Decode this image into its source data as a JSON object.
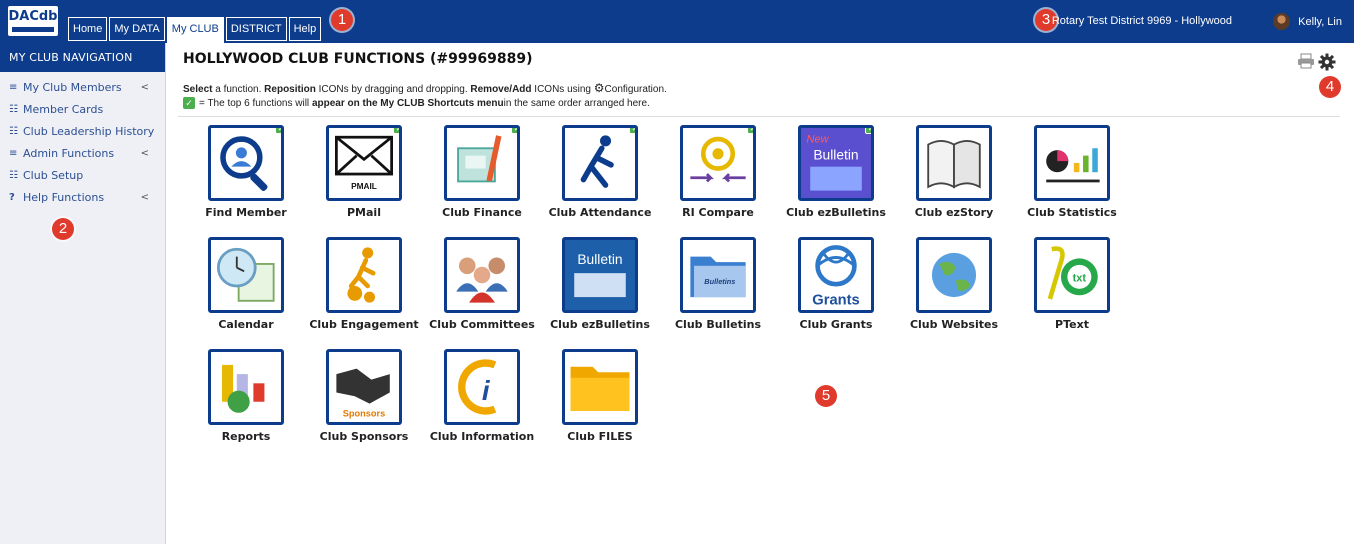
{
  "header": {
    "logo": "DACdb",
    "tabs": [
      {
        "label": "Home"
      },
      {
        "label": "My DATA"
      },
      {
        "label": "My CLUB"
      },
      {
        "label": "DISTRICT"
      },
      {
        "label": "Help"
      }
    ],
    "district": "Rotary Test District 9969 - Hollywood",
    "user": "Kelly, Lin"
  },
  "callouts": [
    "1",
    "2",
    "3",
    "4",
    "5"
  ],
  "sidebar": {
    "title": "MY CLUB NAVIGATION",
    "items": [
      {
        "label": "My Club Members",
        "icon": "menu-icon",
        "chevron": "<"
      },
      {
        "label": "Member Cards",
        "icon": "list-icon",
        "chevron": ""
      },
      {
        "label": "Club Leadership History",
        "icon": "list-icon",
        "chevron": ""
      },
      {
        "label": "Admin Functions",
        "icon": "menu-icon",
        "chevron": "<"
      },
      {
        "label": "Club Setup",
        "icon": "list-icon",
        "chevron": ""
      },
      {
        "label": "Help Functions",
        "icon": "help-icon",
        "chevron": "<"
      }
    ]
  },
  "main": {
    "title": "HOLLYWOOD CLUB FUNCTIONS (#99969889)",
    "instructions": {
      "t1": "Select",
      "t2": " a function. ",
      "t3": "Reposition",
      "t4": " ICONs by dragging and dropping. ",
      "t5": "Remove/Add",
      "t6": " ICONs using ",
      "t7": "Configuration."
    },
    "legend": {
      "t1": "= The top 6 functions will ",
      "t2": "appear on the My CLUB Shortcuts menu",
      "t3": " in the same order arranged here."
    },
    "functions": [
      {
        "label": "Find Member",
        "icon": "find-member-icon",
        "shortcut": true
      },
      {
        "label": "PMail",
        "icon": "pmail-icon",
        "shortcut": true,
        "text": "PMAIL"
      },
      {
        "label": "Club Finance",
        "icon": "finance-icon",
        "shortcut": true
      },
      {
        "label": "Club Attendance",
        "icon": "attendance-icon",
        "shortcut": true
      },
      {
        "label": "RI Compare",
        "icon": "ri-compare-icon",
        "shortcut": true
      },
      {
        "label": "Club ezBulletins",
        "icon": "new-bulletin-icon",
        "shortcut": true,
        "text": "Bulletin",
        "text2": "New"
      },
      {
        "label": "Club ezStory",
        "icon": "book-icon",
        "shortcut": false
      },
      {
        "label": "Club Statistics",
        "icon": "statistics-icon",
        "shortcut": false
      },
      {
        "label": "Calendar",
        "icon": "calendar-icon",
        "shortcut": false
      },
      {
        "label": "Club Engagement",
        "icon": "engagement-icon",
        "shortcut": false
      },
      {
        "label": "Club Committees",
        "icon": "committees-icon",
        "shortcut": false
      },
      {
        "label": "Club ezBulletins",
        "icon": "bulletin-icon",
        "shortcut": false,
        "text": "Bulletin"
      },
      {
        "label": "Club Bulletins",
        "icon": "folder-bulletins-icon",
        "shortcut": false,
        "text": "Bulletins"
      },
      {
        "label": "Club Grants",
        "icon": "grants-icon",
        "shortcut": false,
        "text": "Grants"
      },
      {
        "label": "Club Websites",
        "icon": "globe-icon",
        "shortcut": false
      },
      {
        "label": "PText",
        "icon": "ptext-icon",
        "shortcut": false,
        "text": "txt"
      },
      {
        "label": "Reports",
        "icon": "reports-icon",
        "shortcut": false
      },
      {
        "label": "Club Sponsors",
        "icon": "sponsors-icon",
        "shortcut": false,
        "text": "Sponsors"
      },
      {
        "label": "Club Information",
        "icon": "information-icon",
        "shortcut": false
      },
      {
        "label": "Club FILES",
        "icon": "folder-icon",
        "shortcut": false
      }
    ]
  },
  "colors": {
    "brand": "#0d3c8c",
    "callout": "#e03a2c",
    "check": "#4cae4c"
  }
}
